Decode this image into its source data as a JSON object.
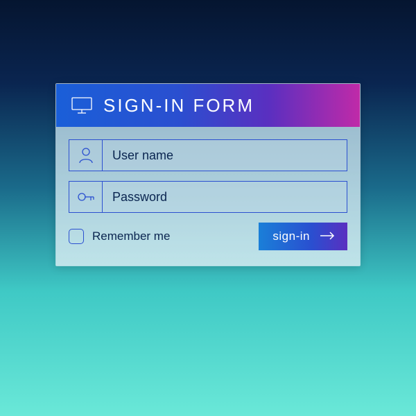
{
  "header": {
    "title": "SIGN-IN FORM"
  },
  "fields": {
    "username": {
      "placeholder": "User name",
      "value": ""
    },
    "password": {
      "placeholder": "Password",
      "value": ""
    }
  },
  "remember": {
    "label": "Remember me",
    "checked": false
  },
  "submit": {
    "label": "sign-in"
  },
  "colors": {
    "accent_start": "#1a5fd8",
    "accent_end": "#c02aa8",
    "border": "#2a4fd0"
  }
}
